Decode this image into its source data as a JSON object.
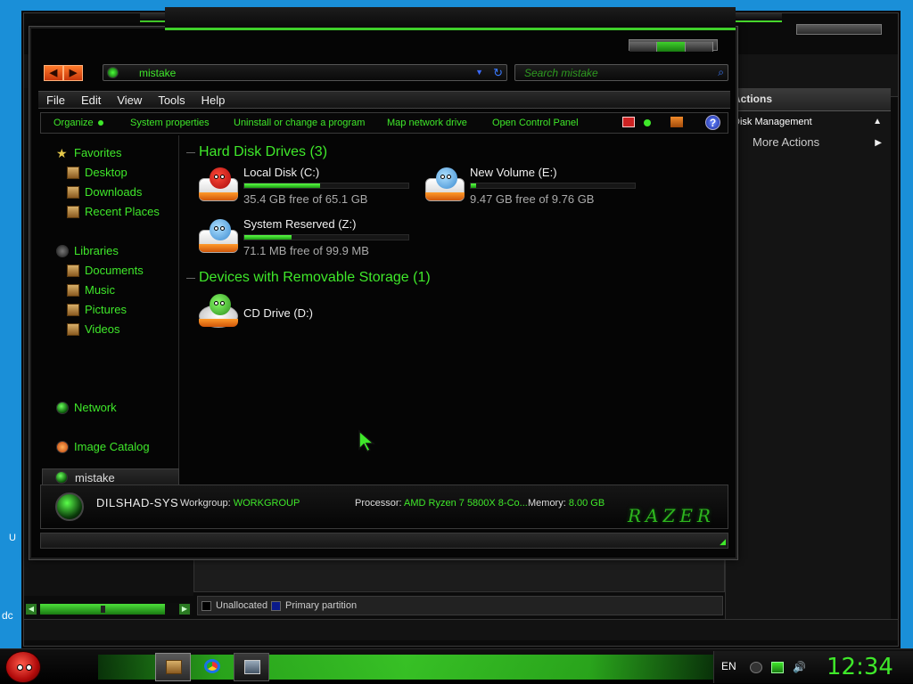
{
  "desktop": {
    "label_left": "dc",
    "label_left2": "U"
  },
  "bg_window": {
    "actions_header": "Actions",
    "actions_item": "Disk Management",
    "actions_more": "More Actions",
    "legend": [
      {
        "label": "Unallocated",
        "color": "#000000"
      },
      {
        "label": "Primary partition",
        "color": "#0a1a8a"
      }
    ]
  },
  "explorer": {
    "address": "mistake",
    "search_placeholder": "Search mistake",
    "menu": [
      "File",
      "Edit",
      "View",
      "Tools",
      "Help"
    ],
    "commands": [
      "Organize",
      "System properties",
      "Uninstall or change a program",
      "Map network drive",
      "Open Control Panel"
    ],
    "nav": {
      "favorites": "Favorites",
      "desktop": "Desktop",
      "downloads": "Downloads",
      "recent": "Recent Places",
      "libraries": "Libraries",
      "documents": "Documents",
      "music": "Music",
      "pictures": "Pictures",
      "videos": "Videos",
      "homegroup": "mistake",
      "network": "Network",
      "image_catalog": "Image Catalog"
    },
    "groups": {
      "hdd": "Hard Disk Drives (3)",
      "removable": "Devices with Removable Storage (1)"
    },
    "drives": [
      {
        "name": "Local Disk (C:)",
        "free": "35.4 GB free of 65.1 GB",
        "used_fraction": 0.46,
        "bird": "red"
      },
      {
        "name": "New Volume (E:)",
        "free": "9.47 GB free of 9.76 GB",
        "used_fraction": 0.03,
        "bird": "blue"
      },
      {
        "name": "System Reserved (Z:)",
        "free": "71.1 MB free of 99.9 MB",
        "used_fraction": 0.29,
        "bird": "blue"
      }
    ],
    "removable": {
      "name": "CD Drive (D:)"
    },
    "details": {
      "computer_name": "DILSHAD-SYS",
      "workgroup_label": "Workgroup:",
      "workgroup": "WORKGROUP",
      "processor_label": "Processor:",
      "processor": "AMD Ryzen 7 5800X 8-Co...",
      "memory_label": "Memory:",
      "memory": "8.00 GB",
      "logo": "RAZER"
    }
  },
  "taskbar": {
    "lang": "EN",
    "clock": "12:34"
  },
  "colors": {
    "accent": "#3fe82a",
    "background": "#050505"
  }
}
